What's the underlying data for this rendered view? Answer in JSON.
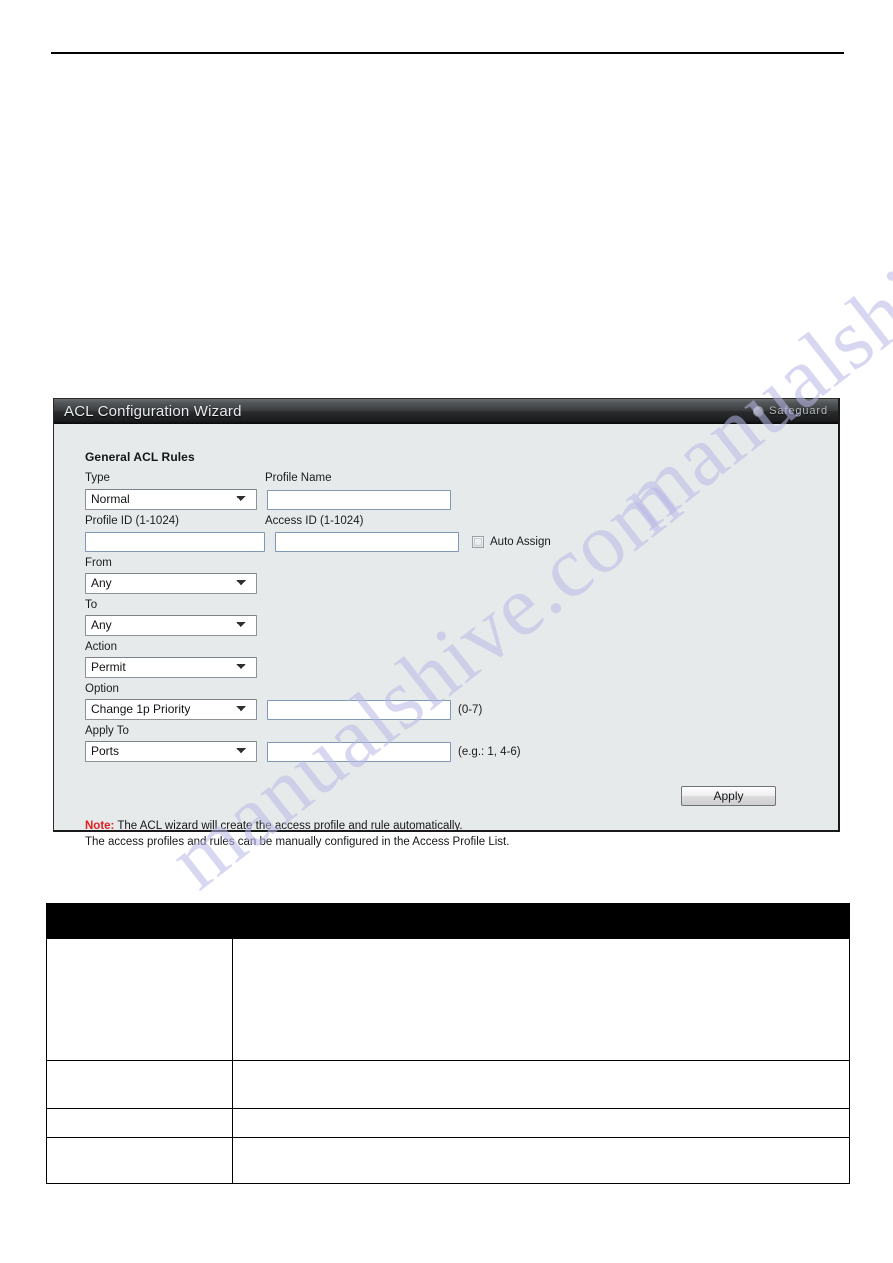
{
  "page": {
    "watermark_text": "manualshive.com",
    "accent_note_color": "#e02020",
    "panel_bg_color": "#e6eaea",
    "header_bar_color": "#2a2c2e"
  },
  "panel": {
    "title": "ACL Configuration Wizard",
    "brand": {
      "label": "Safeguard",
      "icon": "safeguard-circle-icon"
    }
  },
  "form": {
    "section_title": "General ACL Rules",
    "fields": {
      "type": {
        "label": "Type",
        "value": "Normal",
        "options": [
          "Normal"
        ]
      },
      "profile_name": {
        "label": "Profile Name",
        "value": "",
        "placeholder": ""
      },
      "profile_id": {
        "label": "Profile ID (1-1024)",
        "value": "",
        "placeholder": ""
      },
      "access_id": {
        "label": "Access ID (1-1024)",
        "value": "",
        "placeholder": ""
      },
      "auto_assign": {
        "label": "Auto Assign",
        "checked": false
      },
      "from": {
        "label": "From",
        "value": "Any",
        "options": [
          "Any"
        ]
      },
      "to": {
        "label": "To",
        "value": "Any",
        "options": [
          "Any"
        ]
      },
      "action": {
        "label": "Action",
        "value": "Permit",
        "options": [
          "Permit"
        ]
      },
      "option": {
        "label": "Option",
        "value": "Change 1p Priority",
        "options": [
          "Change 1p Priority"
        ],
        "input_value": "",
        "hint": "(0-7)"
      },
      "apply_to": {
        "label": "Apply To",
        "value": "Ports",
        "options": [
          "Ports"
        ],
        "input_value": "",
        "hint": "(e.g.: 1, 4-6)"
      }
    },
    "apply_button": "Apply",
    "note": {
      "prefix": "Note:",
      "line1": " The ACL wizard will create the access profile and rule automatically.",
      "line2": "The access profiles and rules can be manually configured in the Access Profile List."
    }
  },
  "description_table": {
    "headers": [
      "",
      ""
    ],
    "rows": [
      [
        "",
        ""
      ],
      [
        "",
        ""
      ],
      [
        "",
        ""
      ],
      [
        "",
        ""
      ]
    ]
  }
}
